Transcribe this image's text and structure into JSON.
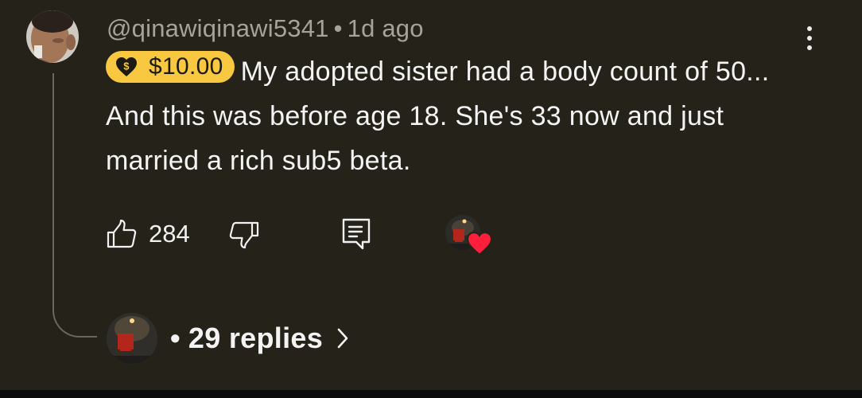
{
  "comment": {
    "author": "@qinawiqinawi5341",
    "separator": "•",
    "timestamp": "1d ago",
    "super_thanks_amount": "$10.00",
    "text": "My adopted sister had a body count of 50... And this was before age 18. She's 33 now and just married a rich sub5 beta.",
    "like_count": "284"
  },
  "replies": {
    "separator": "•",
    "label": "29 replies"
  },
  "colors": {
    "background": "#252219",
    "chip": "#f8c940",
    "heart": "#ff1f3d",
    "meta": "#a7a39a"
  },
  "icons": {
    "menu": "more-vert-icon",
    "like": "thumbs-up-icon",
    "dislike": "thumbs-down-icon",
    "reply": "comment-icon",
    "super_thanks": "heart-dollar-icon",
    "creator_heart": "heart-icon",
    "chevron": "chevron-right-icon"
  }
}
